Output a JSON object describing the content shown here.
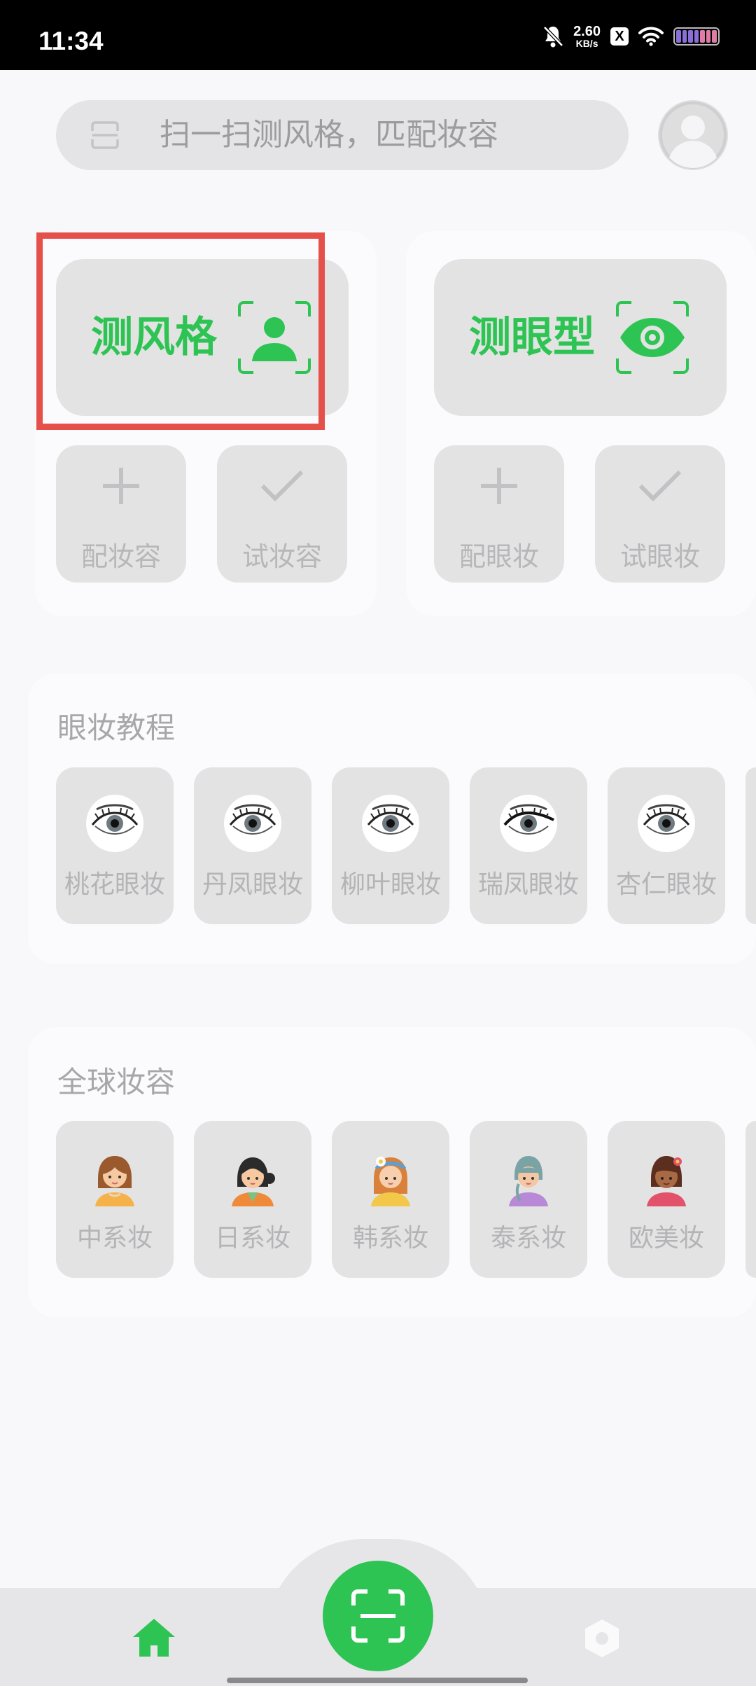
{
  "status_bar": {
    "time": "11:34",
    "net_speed_value": "2.60",
    "net_speed_unit": "KB/s",
    "notification_badge": "X",
    "icons": [
      "bell-off-icon",
      "wifi-icon",
      "battery-icon"
    ]
  },
  "search": {
    "placeholder": "扫一扫测风格，匹配妆容",
    "icon": "scan-icon"
  },
  "profile": {
    "icon": "user-avatar-icon"
  },
  "style_panel": {
    "main_label": "测风格",
    "main_icon": "person-scan-icon",
    "actions": [
      {
        "label": "配妆容",
        "icon": "plus-icon"
      },
      {
        "label": "试妆容",
        "icon": "check-icon"
      }
    ]
  },
  "eye_panel": {
    "main_label": "测眼型",
    "main_icon": "eye-scan-icon",
    "actions": [
      {
        "label": "配眼妆",
        "icon": "plus-icon"
      },
      {
        "label": "试眼妆",
        "icon": "check-icon"
      }
    ]
  },
  "eye_tutorials": {
    "title": "眼妆教程",
    "items": [
      {
        "label": "桃花眼妆",
        "icon": "eye-icon"
      },
      {
        "label": "丹凤眼妆",
        "icon": "eye-icon"
      },
      {
        "label": "柳叶眼妆",
        "icon": "eye-icon"
      },
      {
        "label": "瑞凤眼妆",
        "icon": "eye-icon"
      },
      {
        "label": "杏仁眼妆",
        "icon": "eye-icon"
      }
    ]
  },
  "global_makeup": {
    "title": "全球妆容",
    "items": [
      {
        "label": "中系妆",
        "icon": "chinese-girl-icon"
      },
      {
        "label": "日系妆",
        "icon": "japanese-girl-icon"
      },
      {
        "label": "韩系妆",
        "icon": "korean-girl-icon"
      },
      {
        "label": "泰系妆",
        "icon": "thai-girl-icon"
      },
      {
        "label": "欧美妆",
        "icon": "western-girl-icon"
      }
    ]
  },
  "bottom_nav": {
    "items": [
      {
        "name": "home",
        "icon": "home-icon",
        "active": true
      },
      {
        "name": "scan",
        "icon": "scan-icon"
      },
      {
        "name": "settings",
        "icon": "hexagon-settings-icon"
      }
    ]
  },
  "colors": {
    "accent": "#2ec454",
    "highlight_box": "#e5504a",
    "card": "#e3e3e3",
    "muted_text": "#b4b4b6"
  }
}
